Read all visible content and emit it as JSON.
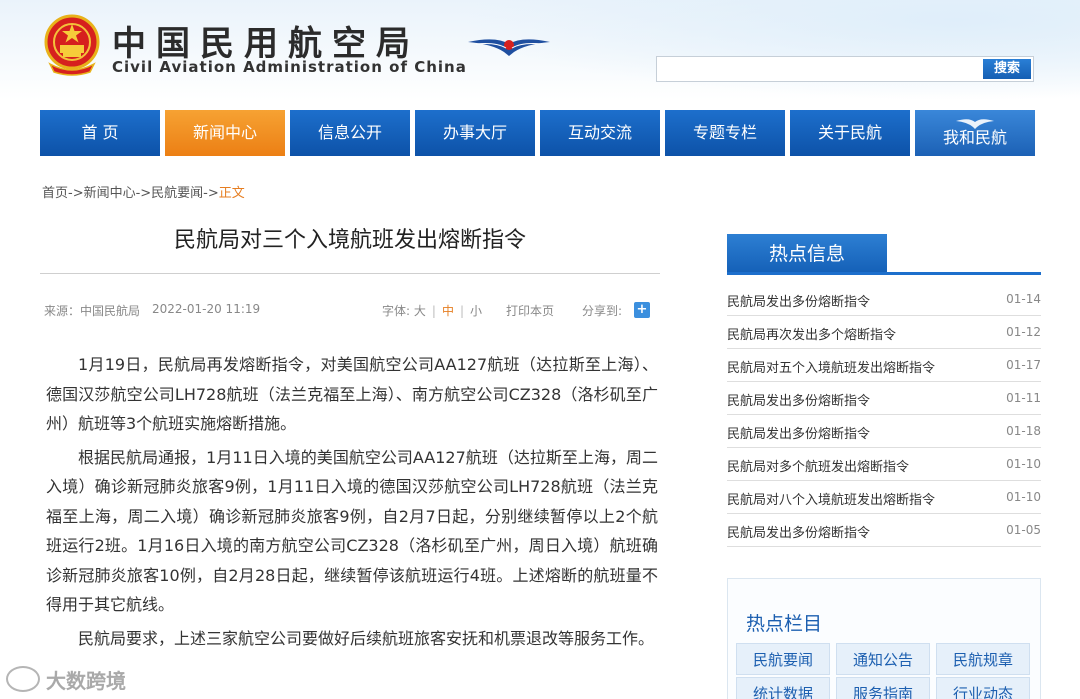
{
  "header": {
    "title_cn": "中国民用航空局",
    "title_en": "Civil Aviation Administration of China",
    "search_placeholder": "",
    "search_button": "搜索"
  },
  "nav": {
    "items": [
      {
        "label": "首 页"
      },
      {
        "label": "新闻中心"
      },
      {
        "label": "信息公开"
      },
      {
        "label": "办事大厅"
      },
      {
        "label": "互动交流"
      },
      {
        "label": "专题专栏"
      },
      {
        "label": "关于民航"
      },
      {
        "label": "我和民航"
      }
    ],
    "active_index": 1
  },
  "breadcrumb": {
    "path": "首页->新闻中心->民航要闻->",
    "current": "正文"
  },
  "article": {
    "title": "民航局对三个入境航班发出熔断指令",
    "source": "来源：中国民航局",
    "date": "2022-01-20 11:19",
    "font_label": "字体:",
    "font_large": "大",
    "font_medium": "中",
    "font_small": "小",
    "print": "打印本页",
    "share": "分享到:",
    "paragraphs": [
      "1月19日，民航局再发熔断指令，对美国航空公司AA127航班（达拉斯至上海）、德国汉莎航空公司LH728航班（法兰克福至上海）、南方航空公司CZ328（洛杉矶至广州）航班等3个航班实施熔断措施。",
      "根据民航局通报，1月11日入境的美国航空公司AA127航班（达拉斯至上海，周二入境）确诊新冠肺炎旅客9例，1月11日入境的德国汉莎航空公司LH728航班（法兰克福至上海，周二入境）确诊新冠肺炎旅客9例，自2月7日起，分别继续暂停以上2个航班运行2班。1月16日入境的南方航空公司CZ328（洛杉矶至广州，周日入境）航班确诊新冠肺炎旅客10例，自2月28日起，继续暂停该航班运行4班。上述熔断的航班量不得用于其它航线。",
      "民航局要求，上述三家航空公司要做好后续航班旅客安抚和机票退改等服务工作。"
    ]
  },
  "sidebar": {
    "hot_title": "热点信息",
    "hot_items": [
      {
        "title": "民航局发出多份熔断指令",
        "date": "01-14"
      },
      {
        "title": "民航局再次发出多个熔断指令",
        "date": "01-12"
      },
      {
        "title": "民航局对五个入境航班发出熔断指令",
        "date": "01-17"
      },
      {
        "title": "民航局发出多份熔断指令",
        "date": "01-11"
      },
      {
        "title": "民航局发出多份熔断指令",
        "date": "01-18"
      },
      {
        "title": "民航局对多个航班发出熔断指令",
        "date": "01-10"
      },
      {
        "title": "民航局对八个入境航班发出熔断指令",
        "date": "01-10"
      },
      {
        "title": "民航局发出多份熔断指令",
        "date": "01-05"
      }
    ],
    "columns_title": "热点栏目",
    "columns": [
      "民航要闻",
      "通知公告",
      "民航规章",
      "统计数据",
      "服务指南",
      "行业动态"
    ]
  },
  "watermark": {
    "text": "大数跨境"
  },
  "colors": {
    "nav_blue": "#1d6fcc",
    "nav_active": "#f08a1c",
    "accent_orange": "#e67e22",
    "link_blue": "#1c5fb0"
  }
}
